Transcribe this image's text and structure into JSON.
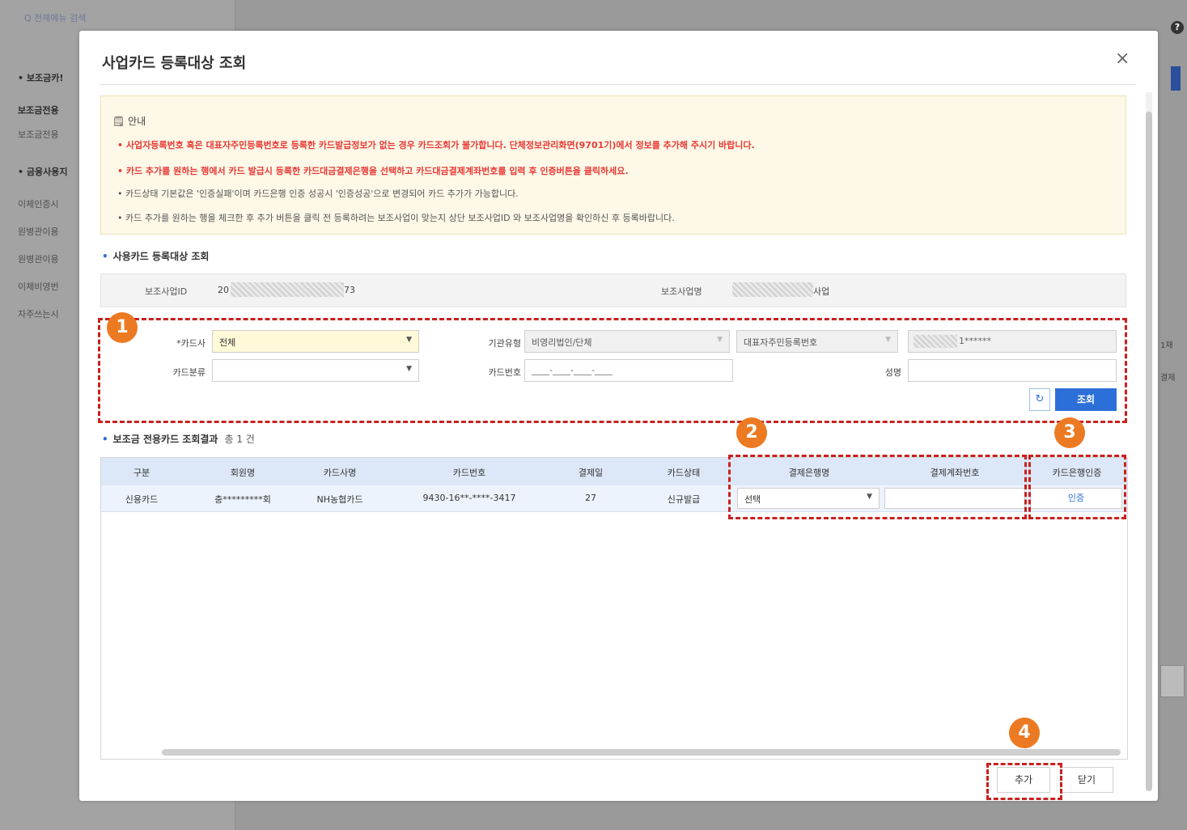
{
  "background": {
    "search_text": "Q 전체메뉴 검색",
    "menu_items": [
      "• 보조금카!",
      "보조금전용",
      "보조금전용",
      "• 금융사용지",
      "이체인증시",
      "원병관이용",
      "원병관이용",
      "이체비영번",
      "자주쓰는시"
    ],
    "right_items": [
      "1재",
      "결제"
    ],
    "help_label": "?"
  },
  "modal": {
    "title": "사업카드 등록대상 조회",
    "close_glyph": "×"
  },
  "notice": {
    "title": "안내",
    "lines": [
      "• 사업자등록번호 혹은 대표자주민등록번호로 등록한 카드발급정보가 없는 경우 카드조회가 불가합니다. 단체정보관리화면(9701기)에서 정보를 추가해 주시기 바랍니다.",
      "• 카드 추가를 원하는 행에서 카드 발급시 등록한 카드대금결제은행을 선택하고 카드대금결제계좌번호를 입력 후 인증버튼을 클릭하세요.",
      "• 카드상태 기본값은 '인증실패'이며 카드은행 인증 성공시 '인증성공'으로 변경되어 카드 추가가 가능합니다.",
      "• 카드 추가를 원하는 행을 체크한 후 추가 버튼을 클릭 전 등록하려는 보조사업이 맞는지 상단 보조사업ID 와 보조사업명을 확인하신 후 등록바랍니다."
    ]
  },
  "search_section": {
    "title": "사용카드 등록대상 조회",
    "project_id_label": "보조사업ID",
    "project_id_prefix": "20",
    "project_id_suffix": "73",
    "project_name_label": "보조사업명",
    "project_name_suffix": "사업"
  },
  "filters": {
    "card_company_label": "*카드사",
    "card_company_value": "전체",
    "org_type_label": "기관유형",
    "org_type_value": "비영리법인/단체",
    "rep_id_select_value": "대표자주민등록번호",
    "rep_id_masked_suffix": "1******",
    "card_class_label": "카드분류",
    "card_class_value": "",
    "card_number_label": "카드번호",
    "card_number_placeholder": "____-____-____-____",
    "name_label": "성명",
    "name_value": "",
    "reset_glyph": "↻",
    "search_button": "조회"
  },
  "results": {
    "title": "보조금 전용카드 조회결과",
    "count_text": "총 1 건",
    "columns": [
      "구분",
      "회원명",
      "카드사명",
      "카드번호",
      "결제일",
      "카드상태",
      "결제은행명",
      "결제계좌번호",
      "카드은행인증"
    ],
    "rows": [
      {
        "type": "신용카드",
        "member": "충*********회",
        "card_company": "NH농협카드",
        "card_number": "9430-16**-****-3417",
        "pay_day": "27",
        "status": "신규발급",
        "bank_select": "선택",
        "account": "",
        "auth_button": "인증"
      }
    ]
  },
  "footer": {
    "add_button": "추가",
    "close_button": "닫기"
  },
  "badges": [
    "1",
    "2",
    "3",
    "4"
  ]
}
